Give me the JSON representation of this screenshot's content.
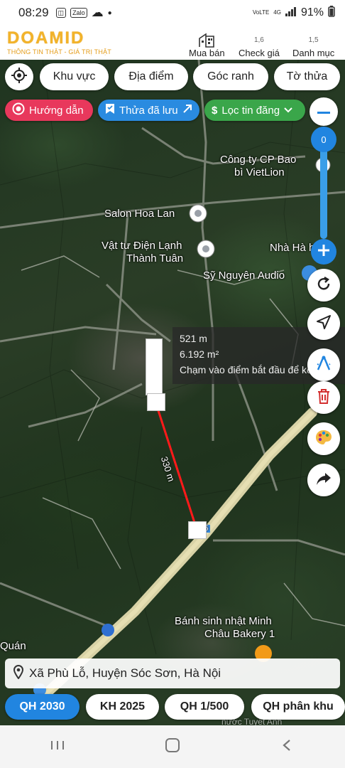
{
  "status_bar": {
    "time": "08:29",
    "app_badges": [
      "Zalo"
    ],
    "network_top": "VoLTE",
    "network_type": "4G",
    "battery": "91%"
  },
  "header": {
    "logo_text": "DOAMID",
    "slogan": "THÔNG TIN THẬT - GIÁ TRỊ THẬT",
    "nav": [
      {
        "label": "Mua bán",
        "icon": "building-icon"
      },
      {
        "label": "Check giá",
        "icon_text": "1,6"
      },
      {
        "label": "Danh mục",
        "icon_text": "1,5"
      }
    ]
  },
  "toolbar": {
    "pills": [
      "Khu vực",
      "Địa điểm",
      "Góc ranh",
      "Tờ thửa"
    ]
  },
  "quick_tags": {
    "guide": "Hướng dẫn",
    "saved": "Thửa đã lưu",
    "filter": "Lọc tin đăng"
  },
  "zoom": {
    "level": "0"
  },
  "map_labels": {
    "company_1": "Công ty CP Bao",
    "company_2": "bì VietLion",
    "salon": "Salon Hoa Lan",
    "supplier_1": "Vật tư Điện Lạnh",
    "supplier_2": "Thành Tuân",
    "nha": "Nhà Hà",
    "nha_suffix": "ha",
    "audio": "Sỹ Nguyên Audio",
    "bakery_1": "Bánh sinh nhật Minh",
    "bakery_2": "Châu Bakery 1",
    "left_partial": "Quán",
    "bottom_partial": "nước Tuyết Anh",
    "road_number": "5",
    "segment_length": "330 m"
  },
  "measure": {
    "distance": "521 m",
    "area": "6.192 m²",
    "hint": "Chạm vào điểm bắt đầu để kết thúc"
  },
  "address": "Xã Phù Lỗ, Huyện Sóc Sơn, Hà Nội",
  "bottom_tabs": [
    "QH 2030",
    "KH 2025",
    "QH 1/500",
    "QH phân khu"
  ],
  "colors": {
    "accent_blue": "#2185e0",
    "guide_pink": "#e8385c",
    "filter_green": "#3aa64a",
    "logo_gold": "#f2b32a",
    "measure_line": "#ff1a1a"
  }
}
